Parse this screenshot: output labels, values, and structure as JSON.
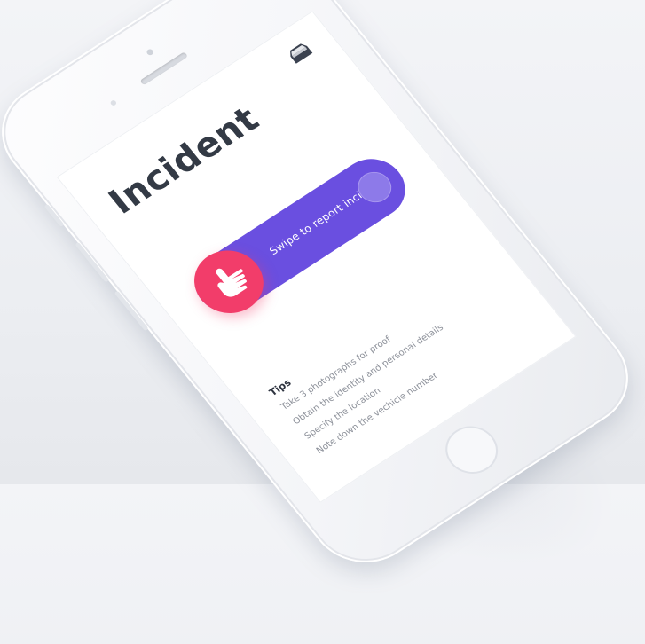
{
  "screen": {
    "title": "Incident",
    "header_icon": "inbox-icon"
  },
  "swipe_control": {
    "label": "Swipe to report incident",
    "handle_icon": "hand-pointer-icon",
    "track_color": "#6a4fe0",
    "handle_color": "#f23d6a"
  },
  "tips": {
    "heading": "Tips",
    "items": [
      {
        "text": "Take 3 photographs for proof"
      },
      {
        "text": "Obtain the identity and personal details"
      },
      {
        "text": "Specify the location"
      },
      {
        "text": "Note down the vechicle number"
      }
    ]
  }
}
